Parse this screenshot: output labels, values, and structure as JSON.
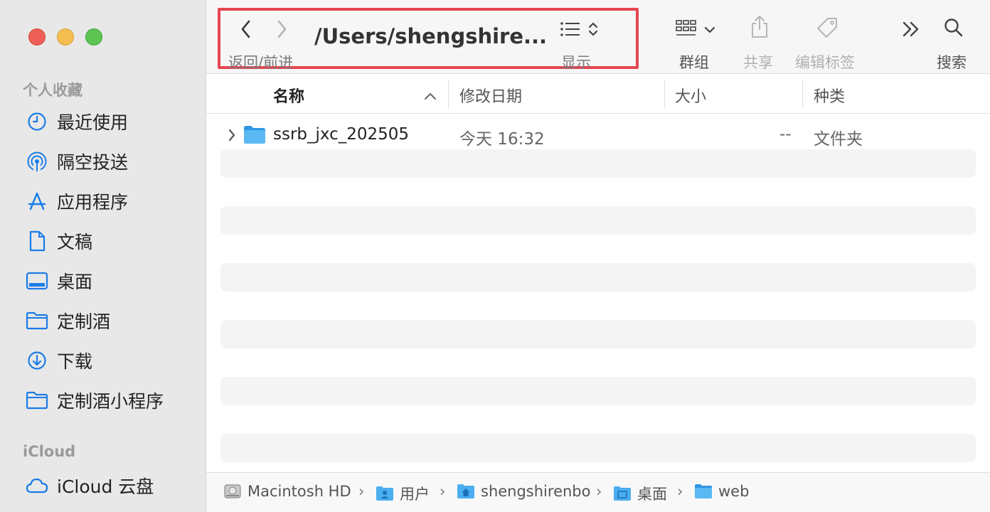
{
  "sidebar": {
    "favorites_header": "个人收藏",
    "icloud_header": "iCloud",
    "items": [
      {
        "label": "最近使用",
        "icon": "clock-icon"
      },
      {
        "label": "隔空投送",
        "icon": "airdrop-icon"
      },
      {
        "label": "应用程序",
        "icon": "applications-icon"
      },
      {
        "label": "文稿",
        "icon": "document-icon"
      },
      {
        "label": "桌面",
        "icon": "desktop-icon"
      },
      {
        "label": "定制酒",
        "icon": "folder-icon"
      },
      {
        "label": "下载",
        "icon": "download-icon"
      },
      {
        "label": "定制酒小程序",
        "icon": "folder-icon"
      }
    ],
    "icloud_items": [
      {
        "label": "iCloud 云盘",
        "icon": "cloud-icon"
      }
    ]
  },
  "toolbar": {
    "back_forward_label": "返回/前进",
    "path_title": "/Users/shengshire...",
    "view_label": "显示",
    "group_label": "群组",
    "share_label": "共享",
    "tags_label": "编辑标签",
    "search_label": "搜索"
  },
  "columns": {
    "name": "名称",
    "modified": "修改日期",
    "size": "大小",
    "kind": "种类"
  },
  "files": [
    {
      "name": "ssrb_jxc_202505",
      "modified": "今天 16:32",
      "size": "--",
      "kind": "文件夹"
    }
  ],
  "pathbar": [
    {
      "label": "Macintosh HD",
      "icon": "hard-drive-icon"
    },
    {
      "label": "用户",
      "icon": "users-folder-icon"
    },
    {
      "label": "shengshirenbo",
      "icon": "home-folder-icon"
    },
    {
      "label": "桌面",
      "icon": "desktop-folder-icon"
    },
    {
      "label": "web",
      "icon": "folder-icon"
    }
  ],
  "colors": {
    "sidebar_icon": "#1a7ce8",
    "highlight_border": "#e64552",
    "folder_blue": "#3fa7ee"
  }
}
